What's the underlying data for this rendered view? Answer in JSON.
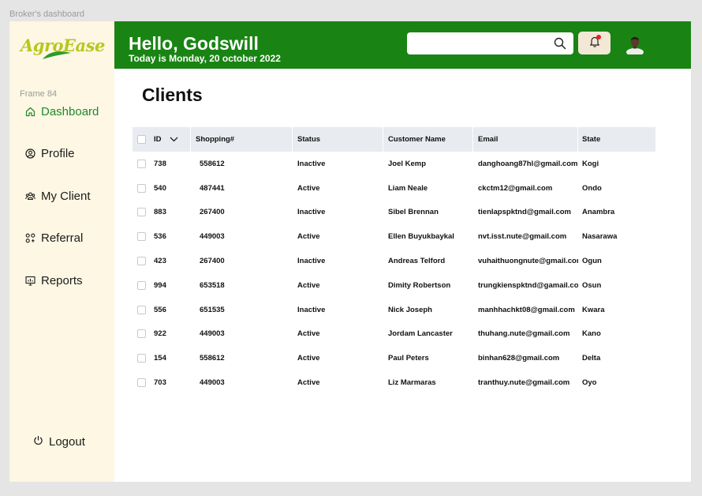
{
  "frame_caption": "Broker's dashboard",
  "brand": {
    "logo_text": "AgroEase",
    "logo_color": "#b9c61f",
    "accent_green": "#198413"
  },
  "sidebar": {
    "frame_label": "Frame 84",
    "items": [
      {
        "label": "Dashboard",
        "icon": "home-icon",
        "active": true
      },
      {
        "label": "Profile",
        "icon": "user-circle-icon",
        "active": false
      },
      {
        "label": "My Client",
        "icon": "users-icon",
        "active": false
      },
      {
        "label": "Referral",
        "icon": "grid-icon",
        "active": false
      },
      {
        "label": "Reports",
        "icon": "report-icon",
        "active": false
      }
    ],
    "logout_label": "Logout"
  },
  "header": {
    "greeting": "Hello, Godswill",
    "date_line": "Today is Monday, 20 october 2022",
    "search_placeholder": "",
    "notification_dot_color": "#e02424"
  },
  "main": {
    "title": "Clients",
    "table": {
      "columns": [
        "ID",
        "Shopping#",
        "Status",
        "Customer Name",
        "Email",
        "State"
      ],
      "rows": [
        [
          "738",
          "558612",
          "Inactive",
          "Joel Kemp",
          "danghoang87hl@gmail.com",
          "Kogi"
        ],
        [
          "540",
          "487441",
          "Active",
          "Liam Neale",
          "ckctm12@gmail.com",
          "Ondo"
        ],
        [
          "883",
          "267400",
          "Inactive",
          "Sibel Brennan",
          "tienlapspktnd@gmail.com",
          "Anambra"
        ],
        [
          "536",
          "449003",
          "Active",
          "Ellen Buyukbaykal",
          "nvt.isst.nute@gmail.com",
          "Nasarawa"
        ],
        [
          "423",
          "267400",
          "Inactive",
          "Andreas Telford",
          "vuhaithuongnute@gmail.com",
          "Ogun"
        ],
        [
          "994",
          "653518",
          "Active",
          "Dimity Robertson",
          "trungkienspktnd@gamail.com",
          "Osun"
        ],
        [
          "556",
          "651535",
          "Inactive",
          "Nick Joseph",
          "manhhachkt08@gmail.com",
          "Kwara"
        ],
        [
          "922",
          "449003",
          "Active",
          "Jordam Lancaster",
          "thuhang.nute@gmail.com",
          "Kano"
        ],
        [
          "154",
          "558612",
          "Active",
          "Paul Peters",
          "binhan628@gmail.com",
          "Delta"
        ],
        [
          "703",
          "449003",
          "Active",
          "Liz Marmaras",
          "tranthuy.nute@gmail.com",
          "Oyo"
        ]
      ]
    }
  }
}
